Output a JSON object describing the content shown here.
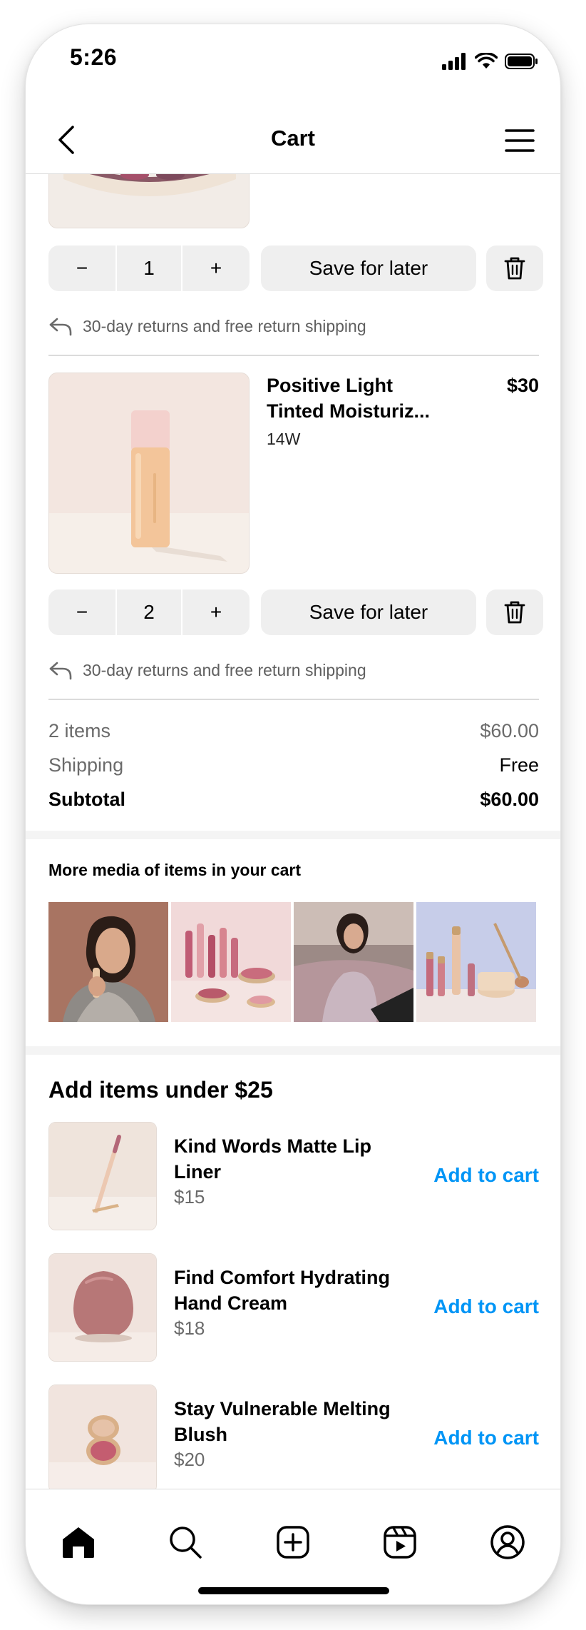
{
  "status": {
    "time": "5:26"
  },
  "header": {
    "title": "Cart",
    "back_icon": "chevron-left-icon",
    "menu_icon": "hamburger-menu-icon"
  },
  "cart_items": [
    {
      "qty": "1",
      "save_label": "Save for later",
      "returns": "30-day returns and free return shipping"
    },
    {
      "name": "Positive Light Tinted Moisturiz...",
      "variant": "14W",
      "price": "$30",
      "qty": "2",
      "save_label": "Save for later",
      "returns": "30-day returns and free return shipping"
    }
  ],
  "summary": {
    "items_label": "2 items",
    "items_value": "$60.00",
    "shipping_label": "Shipping",
    "shipping_value": "Free",
    "subtotal_label": "Subtotal",
    "subtotal_value": "$60.00"
  },
  "media": {
    "title": "More media of items in your cart"
  },
  "recommendations": {
    "title": "Add items under $25",
    "items": [
      {
        "name": "Kind Words Matte Lip Liner",
        "price": "$15",
        "cta": "Add to cart"
      },
      {
        "name": "Find Comfort Hydrating Hand Cream",
        "price": "$18",
        "cta": "Add to cart"
      },
      {
        "name": "Stay Vulnerable Melting Blush",
        "price": "$20",
        "cta": "Add to cart"
      }
    ]
  },
  "qty_controls": {
    "minus": "−",
    "plus": "+"
  },
  "colors": {
    "accent": "#0095f6",
    "button_bg": "#efefef",
    "divider": "#dbdbdb"
  },
  "tabbar": [
    "home-icon",
    "search-icon",
    "create-icon",
    "reels-icon",
    "profile-icon"
  ]
}
